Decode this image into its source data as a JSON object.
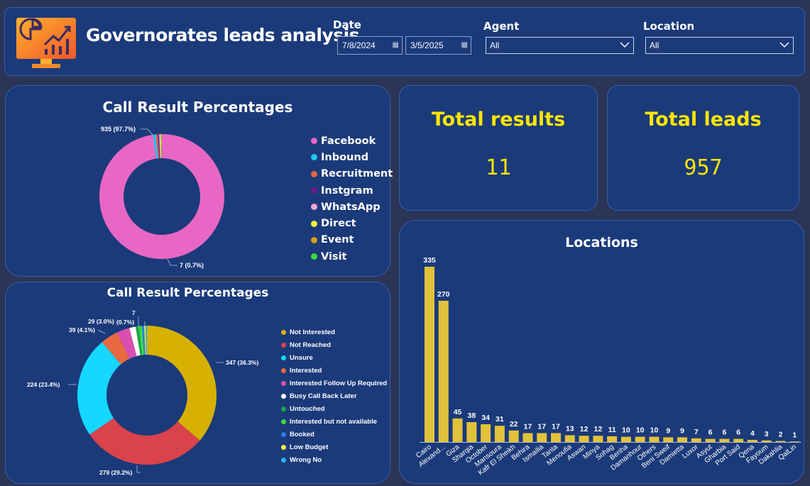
{
  "header": {
    "title": "Governorates leads analysis",
    "date_label": "Date",
    "date_from": "7/8/2024",
    "date_to": "3/5/2025",
    "agent_label": "Agent",
    "agent_value": "All",
    "location_label": "Location",
    "location_value": "All",
    "logo_icon": "monitor-analytics-icon",
    "calendar_icon": "calendar-icon",
    "dropdown_icon": "chevron-down-icon"
  },
  "kpis": {
    "total_results_label": "Total results",
    "total_results_value": "11",
    "total_leads_label": "Total leads",
    "total_leads_value": "957",
    "accent_color": "#ffe600"
  },
  "chart_data": [
    {
      "type": "pie",
      "variant": "donut",
      "title": "Call Result Percentages",
      "categories": [
        "Facebook",
        "Inbound",
        "Recruitment",
        "Instgram",
        "WhatsApp",
        "Direct",
        "Event",
        "Visit"
      ],
      "values": [
        935,
        7,
        5,
        3,
        3,
        2,
        1,
        1
      ],
      "colors": [
        "#e867c4",
        "#1ec8f0",
        "#e0653f",
        "#6a1b8a",
        "#f2a3d6",
        "#f4f442",
        "#d4a017",
        "#3ddc3d"
      ],
      "data_labels": [
        {
          "category": "Facebook",
          "text": "935 (97.7%)"
        },
        {
          "category": "Inbound",
          "text": "7 (0.7%)"
        }
      ],
      "legend_position": "right"
    },
    {
      "type": "pie",
      "variant": "donut",
      "title": "Call Result Percentages",
      "categories": [
        "Not Interested",
        "Not Reached",
        "Unsure",
        "Interested",
        "Interested Follow Up Required",
        "Busy Call Back Later",
        "Untouched",
        "Interested but not available",
        "Booked",
        "Low Budget",
        "Wrong No"
      ],
      "values": [
        347,
        279,
        224,
        39,
        29,
        14,
        7,
        7,
        5,
        3,
        3
      ],
      "colors": [
        "#d7b100",
        "#d9434b",
        "#14d8ff",
        "#e8693f",
        "#d94fb0",
        "#ffffff",
        "#1aa84a",
        "#3ddc3d",
        "#2f7cf0",
        "#f4f442",
        "#22b4f0"
      ],
      "data_labels": [
        {
          "category": "Not Interested",
          "text": "347 (36.3%)"
        },
        {
          "category": "Not Reached",
          "text": "279 (29.2%)"
        },
        {
          "category": "Unsure",
          "text": "224 (23.4%)"
        },
        {
          "category": "Interested",
          "text": "39 (4.1%)"
        },
        {
          "category": "Interested Follow Up Required",
          "text": "29 (3.0%)"
        },
        {
          "category": "Untouched",
          "text": "7"
        },
        {
          "category": "Interested but not available",
          "text": "(0.7%)"
        }
      ],
      "legend_position": "right"
    },
    {
      "type": "bar",
      "title": "Locations",
      "categories": [
        "Cairo",
        "Alexand...",
        "Giza",
        "Sharqia",
        "October",
        "Mansoura",
        "Kafr El Sheikh",
        "Behira",
        "Ismailia",
        "Tanta",
        "Menoufia",
        "Aswan",
        "Minya",
        "Sohag",
        "Benha",
        "Damanhour",
        "Others",
        "Beni Sweif",
        "Damietta",
        "Luxor",
        "Asyut",
        "Gharbia",
        "Port Said",
        "Qena",
        "Fayoum",
        "Dakahlia",
        "QalLin"
      ],
      "values": [
        335,
        270,
        45,
        38,
        34,
        31,
        22,
        17,
        17,
        17,
        13,
        12,
        12,
        11,
        10,
        10,
        10,
        9,
        9,
        7,
        6,
        6,
        6,
        4,
        3,
        2,
        1
      ],
      "color": "#e2c23a",
      "grid": false,
      "ylim": [
        0,
        335
      ]
    }
  ]
}
